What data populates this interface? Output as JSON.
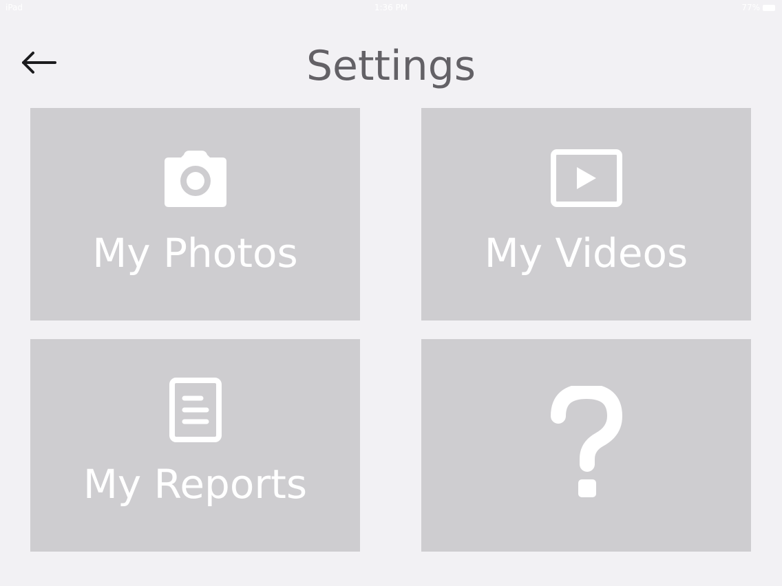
{
  "status_bar": {
    "carrier": "iPad",
    "time": "1:36 PM",
    "battery": "77%"
  },
  "header": {
    "title": "Settings",
    "back_icon": "arrow-left-icon"
  },
  "tiles": [
    {
      "label": "My Photos",
      "icon": "camera-icon"
    },
    {
      "label": "My Videos",
      "icon": "video-play-icon"
    },
    {
      "label": "My Reports",
      "icon": "document-icon"
    },
    {
      "label": "",
      "icon": "question-mark-icon"
    }
  ],
  "colors": {
    "background": "#f2f1f4",
    "tile": "#cecdd0",
    "title": "#636166",
    "tile_text": "#ffffff"
  }
}
